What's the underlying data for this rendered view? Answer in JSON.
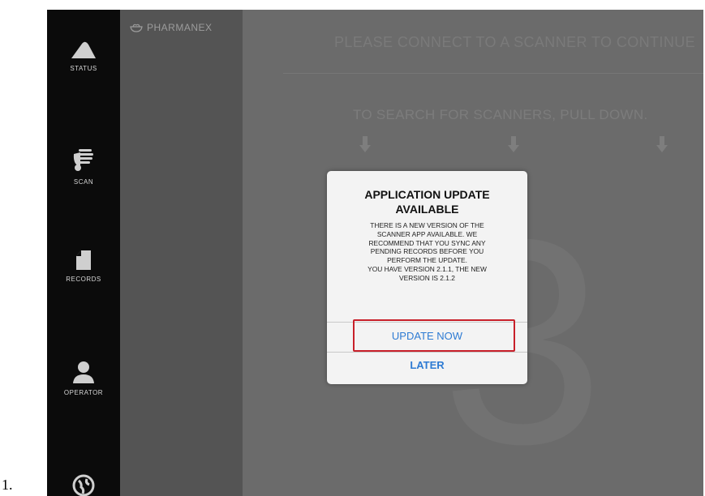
{
  "list_marker": "1.",
  "nav": {
    "items": [
      {
        "label": "STATUS",
        "icon": "status-icon"
      },
      {
        "label": "SCAN",
        "icon": "scan-hand-icon"
      },
      {
        "label": "RECORDS",
        "icon": "records-icon"
      },
      {
        "label": "OPERATOR",
        "icon": "operator-icon"
      },
      {
        "label": "",
        "icon": "globe-icon"
      }
    ]
  },
  "brand": {
    "name": "PHARMANEX",
    "icon": "pharmanex-logo-icon"
  },
  "main": {
    "headline": "PLEASE CONNECT TO A SCANNER TO CONTINUE",
    "subline": "TO SEARCH FOR SCANNERS, PULL DOWN.",
    "countdown": "3"
  },
  "dialog": {
    "title": "APPLICATION UPDATE AVAILABLE",
    "message_lines": [
      "THERE IS A NEW VERSION OF THE",
      "SCANNER APP AVAILABLE. WE",
      "RECOMMEND THAT YOU SYNC ANY",
      "PENDING RECORDS BEFORE YOU",
      "PERFORM THE UPDATE.",
      "YOU HAVE VERSION 2.1.1, THE NEW",
      "VERSION IS 2.1.2"
    ],
    "update_label": "UPDATE NOW",
    "later_label": "LATER"
  },
  "colors": {
    "nav_bg": "#0b0b0b",
    "side_bg": "#545454",
    "main_bg": "#6b6b6b",
    "link_blue": "#2e7bd3",
    "highlight_red": "#c8202a"
  }
}
